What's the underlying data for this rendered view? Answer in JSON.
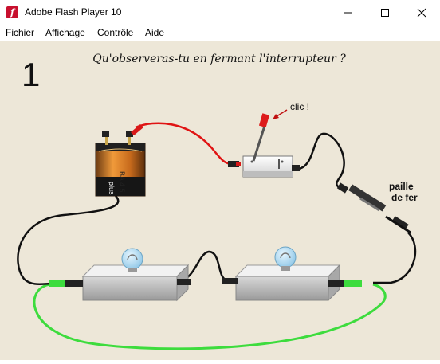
{
  "window": {
    "title": "Adobe Flash Player 10",
    "controls": {
      "minimize": "—",
      "maximize": "☐",
      "close": "✕"
    }
  },
  "menu": [
    "Fichier",
    "Affichage",
    "Contrôle",
    "Aide"
  ],
  "scene": {
    "number": "1",
    "question": "Qu'observeras-tu en fermant l'interrupteur ?",
    "clic_label": "clic !",
    "straw_label_line1": "paille",
    "straw_label_line2": "de fer",
    "battery_label": "plus"
  },
  "colors": {
    "background": "#ede7d8",
    "red_wire": "#e01414",
    "black_wire": "#111111",
    "green_wire": "#3ddc3d"
  }
}
